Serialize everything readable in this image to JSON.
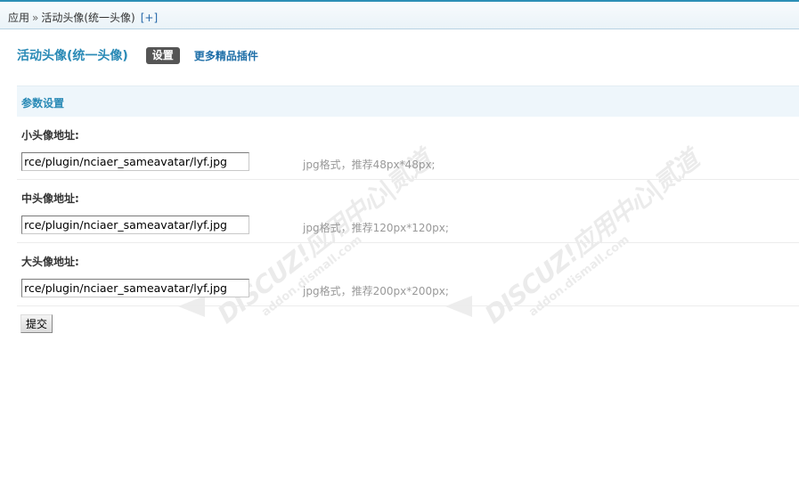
{
  "breadcrumb": {
    "root": "应用",
    "separator": "»",
    "current": "活动头像(统一头像)",
    "add_label": "[+]"
  },
  "plugin": {
    "title": "活动头像(统一头像)",
    "active_tab": "设置",
    "more_link": "更多精品插件"
  },
  "section": {
    "title": "参数设置"
  },
  "settings": [
    {
      "label": "小头像地址:",
      "value": "source/plugin/nciaer_sameavatar/lyf.jpg",
      "hint": "jpg格式，推荐48px*48px;"
    },
    {
      "label": "中头像地址:",
      "value": "source/plugin/nciaer_sameavatar/lyf.jpg",
      "hint": "jpg格式，推荐120px*120px;"
    },
    {
      "label": "大头像地址:",
      "value": "source/plugin/nciaer_sameavatar/lyf.jpg",
      "hint": "jpg格式，推荐200px*200px;"
    }
  ],
  "submit_label": "提交",
  "watermark": {
    "brand": "DISCUZ!应用中心|贰道",
    "url": "addon.dismall.com"
  },
  "colors": {
    "accent": "#2a8ab6",
    "link": "#1f6fa8",
    "section_bg": "#eef6fb",
    "tab_bg": "#555555"
  }
}
